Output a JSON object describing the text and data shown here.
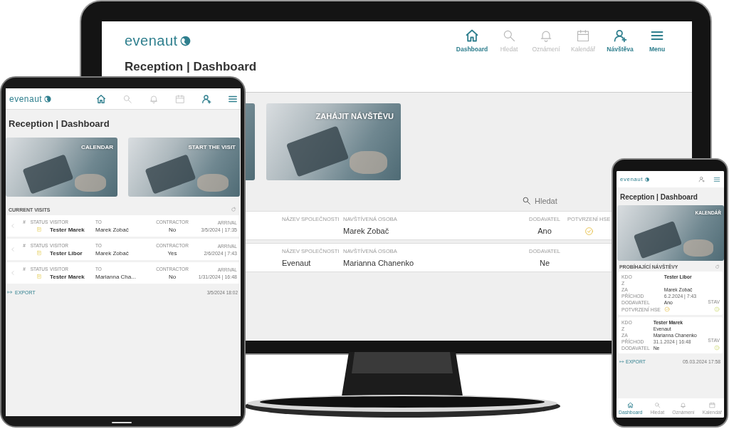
{
  "desktop": {
    "logo": "evenaut",
    "nav": [
      {
        "label": "Dashboard",
        "highlighted": true
      },
      {
        "label": "Hledat",
        "highlighted": false
      },
      {
        "label": "Oznámení",
        "highlighted": false
      },
      {
        "label": "Kalendář",
        "highlighted": false
      },
      {
        "label": "Návštěva",
        "highlighted": true
      },
      {
        "label": "Menu",
        "highlighted": true
      }
    ],
    "page_title": "Reception | Dashboard",
    "tiles": [
      {
        "kind": "photo"
      },
      {
        "kind": "photo",
        "title": "ZAHÁJIT NÁVŠTĚVU"
      }
    ],
    "search": {
      "placeholder": "Hledat"
    },
    "rows": [
      {
        "company_header": "NÁZEV SPOLEČNOSTI",
        "person_header": "NAVŠTÍVENÁ OSOBA",
        "person": "Marek Zobač",
        "contractor_header": "DODAVATEL",
        "contractor": "Ano",
        "hse_header": "POTVRZENÍ HSE",
        "hse_confirmed": true
      },
      {
        "company_header": "NÁZEV SPOLEČNOSTI",
        "company": "Evenaut",
        "person_header": "NAVŠTÍVENÁ OSOBA",
        "person": "Marianna Chanenko",
        "contractor_header": "DODAVATEL",
        "contractor": "Ne",
        "hse_confirmed": false
      }
    ]
  },
  "tablet": {
    "logo": "evenaut",
    "nav": [
      {
        "highlighted": true
      },
      {
        "highlighted": false
      },
      {
        "highlighted": false
      },
      {
        "highlighted": false
      },
      {
        "highlighted": true
      },
      {
        "highlighted": true
      }
    ],
    "page_title": "Reception | Dashboard",
    "tiles": [
      {
        "kind": "photo",
        "title": "CALENDAR"
      },
      {
        "kind": "photo",
        "title": "START THE VISIT"
      }
    ],
    "section_title": "CURRENT VISITS",
    "visits": [
      {
        "headers": [
          "#",
          "STATUS",
          "VISITOR",
          "TO",
          "CONTRACTOR",
          "ARRIVAL"
        ],
        "visitor": "Tester Marek",
        "to": "Marek Zobač",
        "contractor": "No",
        "arrival": "3/5/2024 | 17:35"
      },
      {
        "headers": [
          "#",
          "STATUS",
          "VISITOR",
          "TO",
          "CONTRACTOR",
          "ARRIVAL"
        ],
        "visitor": "Tester Libor",
        "to": "Marek Zobač",
        "contractor": "Yes",
        "arrival": "2/6/2024 | 7:43"
      },
      {
        "headers": [
          "#",
          "STATUS",
          "VISITOR",
          "TO",
          "CONTRACTOR",
          "ARRIVAL"
        ],
        "visitor": "Tester Marek",
        "to": "Marianna Cha...",
        "contractor": "No",
        "arrival": "1/31/2024 | 16:48"
      }
    ],
    "export": "EXPORT",
    "updated": "3/5/2024 18:02"
  },
  "phone": {
    "logo": "evenaut",
    "page_title": "Reception | Dashboard",
    "tile": {
      "kind": "photo",
      "title": "KALENDÁŘ"
    },
    "section_title": "PROBÍHAJÍCÍ NÁVŠTĚVY",
    "cards": [
      {
        "fields": [
          {
            "label": "KDO",
            "value": "Tester Libor"
          },
          {
            "label": "Z"
          },
          {
            "label": "ZA",
            "value": "Marek Zobač"
          },
          {
            "label": "PŘÍCHOD",
            "value": "6.2.2024 | 7:43"
          },
          {
            "label": "DODAVATEL",
            "value": "Ano"
          }
        ],
        "hse": {
          "label": "POTVRZENÍ HSE",
          "confirmed": true
        },
        "status_label": "STAV"
      },
      {
        "fields": [
          {
            "label": "KDO",
            "value": "Tester Marek"
          },
          {
            "label": "Z",
            "value": "Evenaut"
          },
          {
            "label": "ZA",
            "value": "Marianna Chanenko"
          },
          {
            "label": "PŘÍCHOD",
            "value": "31.1.2024 | 16:48"
          },
          {
            "label": "DODAVATEL",
            "value": "Ne"
          }
        ],
        "status_label": "STAV"
      }
    ],
    "export": "EXPORT",
    "updated": "05.03.2024 17:58",
    "bottom_nav": [
      {
        "label": "Dashboard",
        "selected": true
      },
      {
        "label": "Hledat",
        "selected": false
      },
      {
        "label": "Oznámení",
        "selected": false
      },
      {
        "label": "Kalendář",
        "selected": false
      }
    ]
  }
}
